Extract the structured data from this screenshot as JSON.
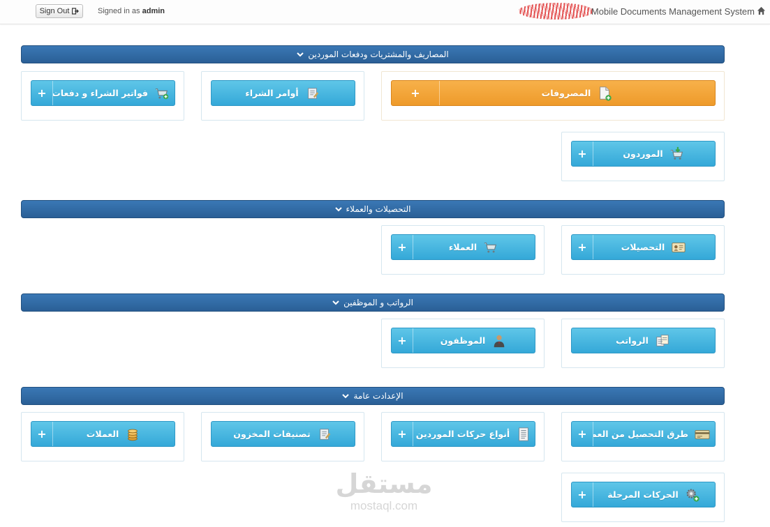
{
  "topbar": {
    "signout_label": "Sign Out",
    "signed_prefix": "Signed in as",
    "username": "admin",
    "brand_title": "Mobile Documents Management System"
  },
  "sections": [
    {
      "title": "المصاريف والمشتريات ودفعات الموردين",
      "tiles": [
        {
          "label": "المصروفات",
          "icon": "add-document-icon"
        },
        {
          "label": "أوامر الشراء",
          "icon": "notepad-icon"
        },
        {
          "label": "فواتير الشراء و دفعات الموردين",
          "icon": "cart-add-icon"
        },
        {
          "label": "الموردون",
          "icon": "cart-download-icon"
        }
      ]
    },
    {
      "title": "التحصيلات والعملاء",
      "tiles": [
        {
          "label": "التحصيلات",
          "icon": "id-card-icon"
        },
        {
          "label": "العملاء",
          "icon": "cart-icon"
        }
      ]
    },
    {
      "title": "الرواتب و الموظفين",
      "tiles": [
        {
          "label": "الرواتب",
          "icon": "documents-icon"
        },
        {
          "label": "الموظفون",
          "icon": "employee-icon"
        }
      ]
    },
    {
      "title": "الإعدادت عامة",
      "tiles": [
        {
          "label": "طرق التحصيل من العملاء",
          "icon": "credit-card-icon"
        },
        {
          "label": "أنواع حركات الموردين",
          "icon": "list-document-icon"
        },
        {
          "label": "تصنيفات المخزون",
          "icon": "notepad-icon"
        },
        {
          "label": "العملات",
          "icon": "coins-icon"
        },
        {
          "label": "الحركات المرحلة",
          "icon": "gear-add-icon"
        }
      ]
    }
  ],
  "watermark": {
    "arabic": "مستقل",
    "latin": "mostaql.com"
  },
  "colors": {
    "header": "#2f6aa5",
    "tile": "#3eb2de",
    "tile_highlight": "#f2a23a"
  }
}
